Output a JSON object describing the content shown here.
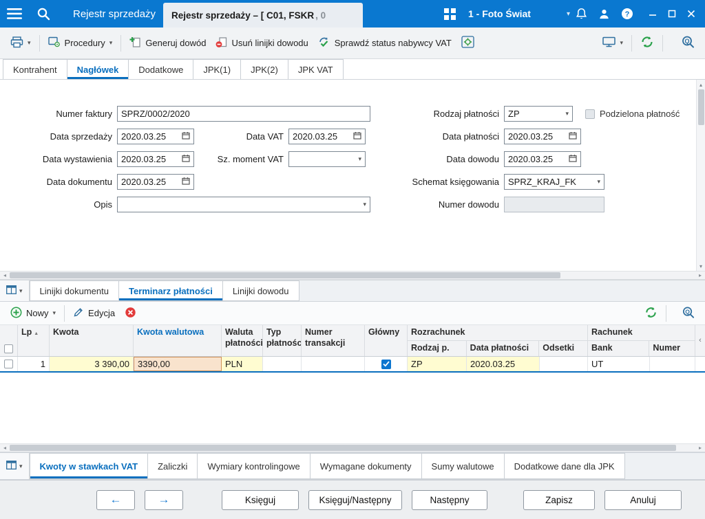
{
  "colors": {
    "titlebar": "#0a78d0",
    "accent": "#0a6fbe",
    "cell_yellow": "#fffcd1",
    "selected_cell": "#f9e3cd",
    "refresh_green": "#2aa14b",
    "delete_red": "#e23b3b"
  },
  "icons": {
    "caret_down": "▾",
    "sort_asc": "▲",
    "check": "✓",
    "scroll_left": "‹",
    "scroll_up": "▴",
    "scroll_down": "▾",
    "tri_left": "◂",
    "tri_right": "▸",
    "arrow_left": "←",
    "arrow_right": "→",
    "question": "?"
  },
  "titlebar": {
    "app_title": "Rejestr sprzedaży",
    "doc_tab_main": "Rejestr sprzedaży – [ C01, FSKR",
    "doc_tab_suffix": ", 0",
    "company": "1 - Foto Świat"
  },
  "toolbar": {
    "procedury": "Procedury",
    "generuj_dowod": "Generuj dowód",
    "usun_linijki_dowodu": "Usuń linijki dowodu",
    "sprawdz_status_vat": "Sprawdź status nabywcy VAT"
  },
  "main_tabs": [
    {
      "label": "Kontrahent"
    },
    {
      "label": "Nagłówek"
    },
    {
      "label": "Dodatkowe"
    },
    {
      "label": "JPK(1)"
    },
    {
      "label": "JPK(2)"
    },
    {
      "label": "JPK VAT"
    }
  ],
  "form": {
    "numer_faktury": {
      "label": "Numer faktury",
      "value": "SPRZ/0002/2020"
    },
    "data_sprzedazy": {
      "label": "Data sprzedaży",
      "value": "2020.03.25"
    },
    "data_vat": {
      "label": "Data VAT",
      "value": "2020.03.25"
    },
    "data_wystawienia": {
      "label": "Data wystawienia",
      "value": "2020.03.25"
    },
    "sz_moment_vat": {
      "label": "Sz. moment VAT",
      "value": ""
    },
    "data_dokumentu": {
      "label": "Data dokumentu",
      "value": "2020.03.25"
    },
    "opis": {
      "label": "Opis",
      "value": ""
    },
    "rodzaj_platnosci": {
      "label": "Rodzaj płatności",
      "value": "ZP"
    },
    "podzielona_platnosc": {
      "label": "Podzielona płatność",
      "checked": false
    },
    "data_platnosci": {
      "label": "Data płatności",
      "value": "2020.03.25"
    },
    "data_dowodu": {
      "label": "Data dowodu",
      "value": "2020.03.25"
    },
    "schemat_ksiegowania": {
      "label": "Schemat księgowania",
      "value": "SPRZ_KRAJ_FK"
    },
    "numer_dowodu": {
      "label": "Numer dowodu",
      "value": ""
    }
  },
  "middle_tabs": [
    {
      "label": "Linijki dokumentu"
    },
    {
      "label": "Terminarz płatności"
    },
    {
      "label": "Linijki dowodu"
    }
  ],
  "grid_toolbar": {
    "nowy": "Nowy",
    "edycja": "Edycja"
  },
  "grid": {
    "headers": {
      "lp": "Lp",
      "kwota": "Kwota",
      "kwota_walutowa": "Kwota walutowa",
      "waluta_l1": "Waluta",
      "waluta_l2": "płatności",
      "typ_l1": "Typ",
      "typ_l2": "płatności",
      "ntrans_l1": "Numer",
      "ntrans_l2": "transakcji",
      "glowny": "Główny",
      "rozrachunek": "Rozrachunek",
      "rodzaj_p": "Rodzaj p.",
      "data_platnosci": "Data płatności",
      "odsetki": "Odsetki",
      "rachunek": "Rachunek",
      "bank": "Bank",
      "numer": "Numer"
    },
    "rows": [
      {
        "lp": "1",
        "kwota": "3 390,00",
        "kwota_walutowa": "3390,00",
        "waluta": "PLN",
        "typ": "",
        "numer_transakcji": "",
        "glowny": true,
        "rodzaj_p": "ZP",
        "data_platnosci": "2020.03.25",
        "odsetki": "",
        "bank": "UT",
        "numer": ""
      }
    ]
  },
  "bottom_tabs": [
    {
      "label": "Kwoty w stawkach VAT"
    },
    {
      "label": "Zaliczki"
    },
    {
      "label": "Wymiary kontrolingowe"
    },
    {
      "label": "Wymagane dokumenty"
    },
    {
      "label": "Sumy walutowe"
    },
    {
      "label": "Dodatkowe dane dla JPK"
    }
  ],
  "buttons": {
    "ksieguj": "Księguj",
    "ksieguj_nastepny": "Księguj/Następny",
    "nastepny": "Następny",
    "zapisz": "Zapisz",
    "anuluj": "Anuluj"
  }
}
